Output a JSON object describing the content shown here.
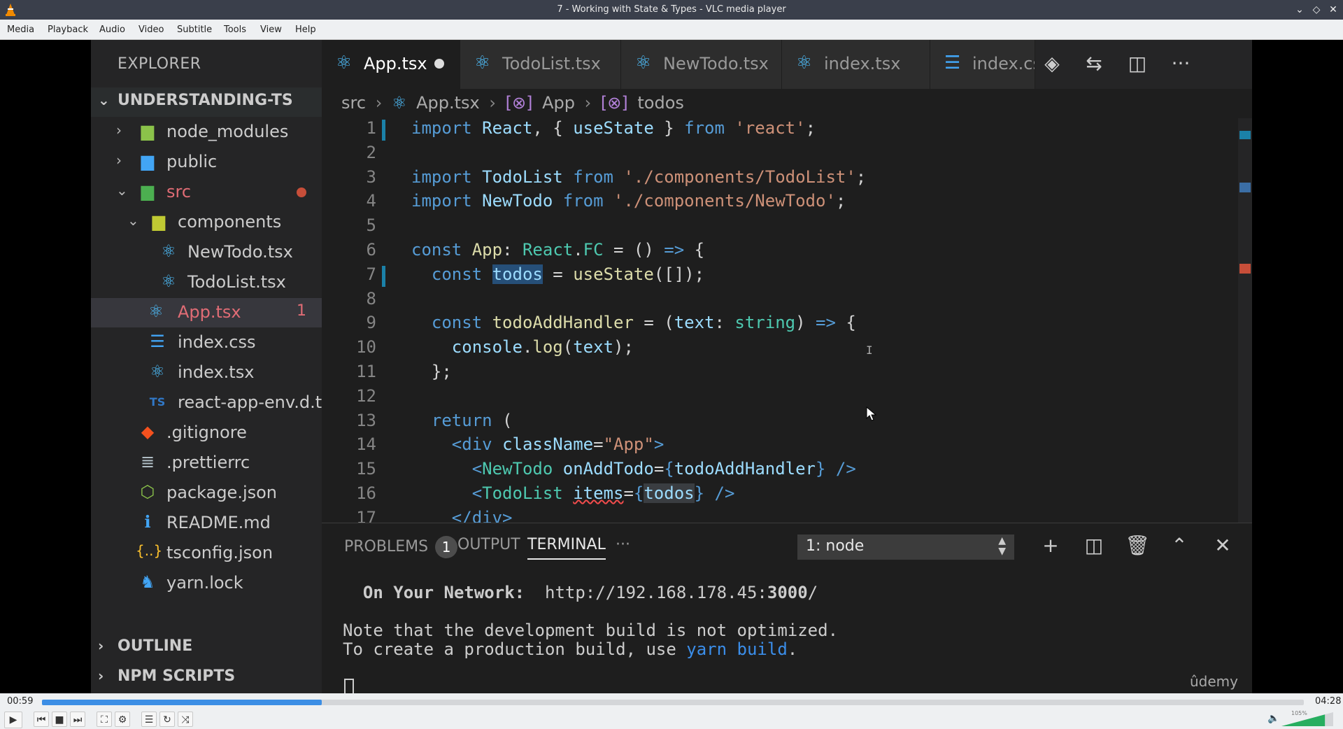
{
  "window": {
    "title": "7 - Working with State & Types - VLC media player"
  },
  "menu": [
    "Media",
    "Playback",
    "Audio",
    "Video",
    "Subtitle",
    "Tools",
    "View",
    "Help"
  ],
  "vscode": {
    "explorer_title": "EXPLORER",
    "project": "UNDERSTANDING-TS",
    "tree": [
      {
        "name": "node_modules",
        "kind": "folder",
        "icon": "node-folder-icon",
        "expanded": false
      },
      {
        "name": "public",
        "kind": "folder",
        "icon": "public-folder-icon",
        "expanded": false
      },
      {
        "name": "src",
        "kind": "folder",
        "icon": "src-folder-icon",
        "expanded": true,
        "status": "error-dot"
      },
      {
        "name": "components",
        "kind": "folder",
        "icon": "folder-icon",
        "expanded": true
      },
      {
        "name": "NewTodo.tsx",
        "kind": "file",
        "icon": "react-icon"
      },
      {
        "name": "TodoList.tsx",
        "kind": "file",
        "icon": "react-icon"
      },
      {
        "name": "App.tsx",
        "kind": "file",
        "icon": "react-icon",
        "active": true,
        "badge": "1"
      },
      {
        "name": "index.css",
        "kind": "file",
        "icon": "css-icon"
      },
      {
        "name": "index.tsx",
        "kind": "file",
        "icon": "react-icon"
      },
      {
        "name": "react-app-env.d.ts",
        "kind": "file",
        "icon": "ts-icon"
      },
      {
        "name": ".gitignore",
        "kind": "file",
        "icon": "git-icon"
      },
      {
        "name": ".prettierrc",
        "kind": "file",
        "icon": "prettier-icon"
      },
      {
        "name": "package.json",
        "kind": "file",
        "icon": "node-icon"
      },
      {
        "name": "README.md",
        "kind": "file",
        "icon": "info-icon"
      },
      {
        "name": "tsconfig.json",
        "kind": "file",
        "icon": "json-icon"
      },
      {
        "name": "yarn.lock",
        "kind": "file",
        "icon": "yarn-icon"
      }
    ],
    "outline_label": "OUTLINE",
    "npm_label": "NPM SCRIPTS",
    "tabs": [
      {
        "name": "App.tsx",
        "active": true,
        "modified": true
      },
      {
        "name": "TodoList.tsx"
      },
      {
        "name": "NewTodo.tsx"
      },
      {
        "name": "index.tsx"
      },
      {
        "name": "index.cs"
      }
    ],
    "breadcrumb": [
      "src",
      "App.tsx",
      "App",
      "todos"
    ],
    "code_line_numbers": [
      "1",
      "2",
      "3",
      "4",
      "5",
      "6",
      "7",
      "8",
      "9",
      "10",
      "11",
      "12",
      "13",
      "14",
      "15",
      "16",
      "17"
    ],
    "panel": {
      "problems_label": "PROBLEMS",
      "problems_count": "1",
      "output_label": "OUTPUT",
      "terminal_label": "TERMINAL",
      "more": "···",
      "terminal_select": "1: node",
      "terminal_lines": {
        "network_label": "On Your Network:",
        "network_url": "http://192.168.178.45:",
        "network_port": "3000",
        "network_tail": "/",
        "note1": "Note that the development build is not optimized.",
        "note2_pre": "To create a production build, use ",
        "note2_cmd": "yarn build",
        "note2_post": "."
      }
    },
    "watermark": "ûdemy"
  },
  "player": {
    "elapsed": "00:59",
    "total": "04:28",
    "progress_fraction": 0.222,
    "volume_label": "105%",
    "volume_fraction": 0.84,
    "accent": "#3c8ee5"
  }
}
